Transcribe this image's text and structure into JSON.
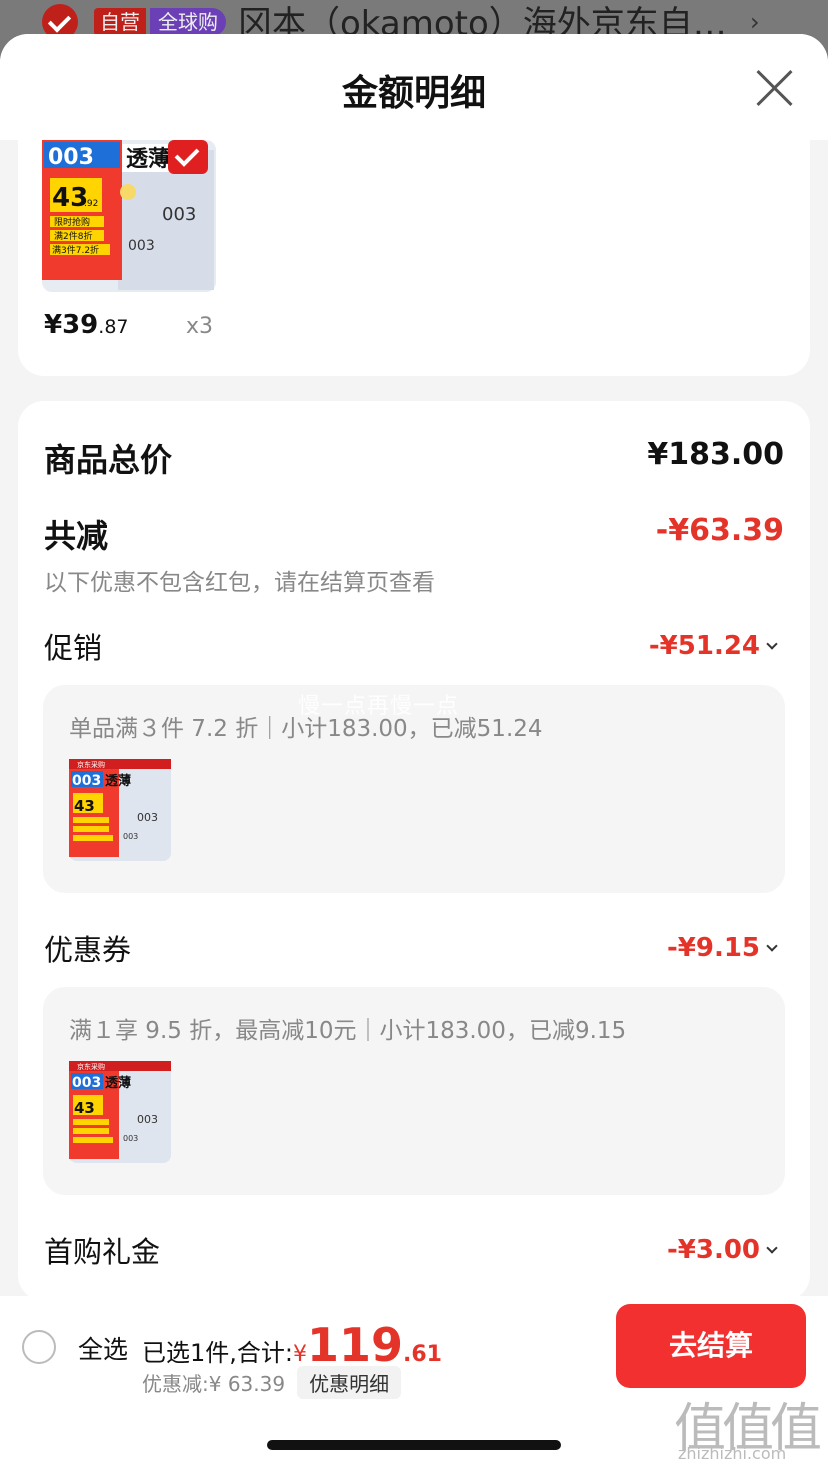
{
  "background": {
    "tag_self": "自营",
    "tag_global": "全球购",
    "shop_name": "冈本（okamoto）海外京东自…",
    "arrow": "›"
  },
  "sheet": {
    "title": "金额明细",
    "close_icon": "close-icon"
  },
  "product": {
    "image_brand": "003",
    "image_title": "透薄",
    "image_price": "43",
    "image_price_sub": ".92",
    "image_line1": "限时抢购",
    "image_line2": "满2件8折",
    "image_line3": "满3件7.2折",
    "price_int": "¥39",
    "price_dec": ".87",
    "qty": "x3"
  },
  "detail": {
    "total_label": "商品总价",
    "total_value": "¥183.00",
    "reduce_label": "共减",
    "reduce_value": "-¥63.39",
    "reduce_note": "以下优惠不包含红包，请在结算页查看",
    "promo_label": "促销",
    "promo_value": "-¥51.24",
    "promo_desc": "单品满３件 7.2 折｜小计183.00，已减51.24",
    "watermark": "慢一点再慢一点",
    "coupon_label": "优惠券",
    "coupon_value": "-¥9.15",
    "coupon_desc": "满１享 9.5 折，最高减10元｜小计183.00，已减9.15",
    "gift_label": "首购礼金",
    "gift_value": "-¥3.00",
    "thumb_store": "京东采购"
  },
  "bottom": {
    "select_all": "全选",
    "summary_prefix": "已选1件,合计:",
    "yen": "¥",
    "total_int": "119",
    "total_dec": ".61",
    "discount_text": "优惠减:¥ 63.39",
    "detail_chip": "优惠明细",
    "checkout": "去结算"
  },
  "watermark_logo": "值值值",
  "watermark_url": "zhizhizhi.com",
  "colors": {
    "accent_red": "#e4342a",
    "button_red": "#f23030",
    "background_gray": "#f4f4f4"
  }
}
